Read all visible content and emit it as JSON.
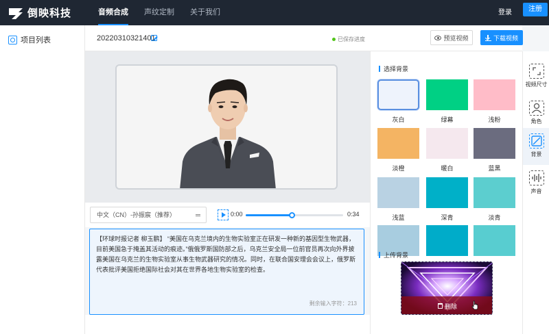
{
  "nav": {
    "brand": "倒映科技",
    "items": [
      "音频合成",
      "声纹定制",
      "关于我们"
    ],
    "active_index": 0,
    "login": "登录",
    "register": "注册"
  },
  "sidebar": {
    "items": [
      {
        "label": "项目列表",
        "icon": "project-list-icon"
      }
    ]
  },
  "project": {
    "name": "20220310321401",
    "saved_status": "已保存进度",
    "preview_label": "预览视频",
    "download_label": "下载视频"
  },
  "player": {
    "voice": "中文（CN）-孙振宸（推荐）",
    "time_current": "0:00",
    "time_total": "0:34",
    "progress": 0.47
  },
  "script": {
    "text": "【环球时报记者 柳玉鹏】 “美国在乌克兰境内的生物实验室正在研发一种新的基因型生物武器，目前美国急于掩盖其活动的痕迹。”俄俄罗斯国防部之后，乌克兰安全局一位前官员再次向外界披露美国在乌克兰的生物实验室从事生物武器研究的情况。同时，在联合国安理会会议上，俄罗斯代表批评美国拒绝国际社会对其在世界各地生物实验室的检查。",
    "remaining": "剩余输入字符：213"
  },
  "background": {
    "section_title": "选择背景",
    "swatches": [
      {
        "label": "灰白",
        "color": "#eef3fc",
        "selected": true
      },
      {
        "label": "绿幕",
        "color": "#00d084",
        "selected": false
      },
      {
        "label": "浅粉",
        "color": "#ffbcc8",
        "selected": false
      },
      {
        "label": "淡橙",
        "color": "#f4b463",
        "selected": false
      },
      {
        "label": "暖白",
        "color": "#f5e8ee",
        "selected": false
      },
      {
        "label": "蓝黑",
        "color": "#6b6c7f",
        "selected": false
      },
      {
        "label": "浅蓝",
        "color": "#b9d2e3",
        "selected": false
      },
      {
        "label": "深青",
        "color": "#00b0c8",
        "selected": false
      },
      {
        "label": "淡青",
        "color": "#5ccecf",
        "selected": false
      },
      {
        "label": "",
        "color": "#a8cde0",
        "selected": false
      },
      {
        "label": "",
        "color": "#00acc9",
        "selected": false
      },
      {
        "label": "",
        "color": "#58cdd0",
        "selected": false
      }
    ],
    "upload_title": "上传背景",
    "delete_label": "删除"
  },
  "rail": {
    "items": [
      {
        "label": "视频尺寸",
        "icon": "video-size-icon",
        "active": false
      },
      {
        "label": "角色",
        "icon": "character-icon",
        "active": false
      },
      {
        "label": "背景",
        "icon": "background-icon",
        "active": true
      },
      {
        "label": "声音",
        "icon": "sound-icon",
        "active": false
      }
    ]
  },
  "colors": {
    "accent": "#1890ff",
    "nav_bg": "#1f2733",
    "saved_dot": "#52c41a"
  }
}
